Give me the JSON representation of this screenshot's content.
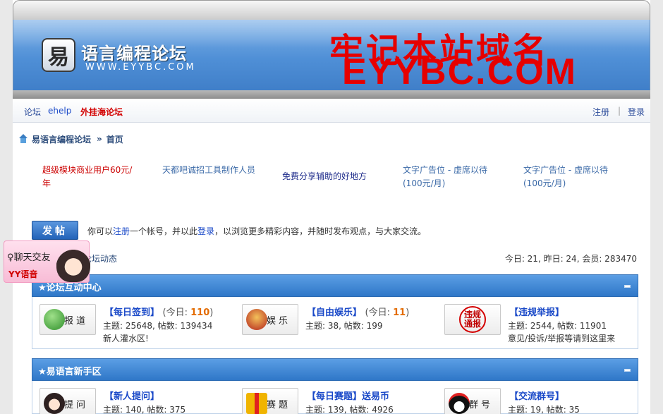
{
  "header": {
    "logo_char": "易",
    "logo_title": "语言编程论坛",
    "logo_url": "WWW.EYYBC.COM",
    "ad_cn": "牢记本站域名",
    "ad_en": "EYYBC.COM"
  },
  "nav": {
    "left": [
      "论坛",
      "ehelp",
      "外挂海论坛"
    ],
    "right": [
      "注册",
      "登录"
    ],
    "sep": "|"
  },
  "breadcrumb": {
    "site": "易语言编程论坛",
    "sep": "»",
    "current": "首页"
  },
  "text_ads": [
    "超级模块商业用户60元/年",
    "天都吧诚招工具制作人员",
    "免费分享辅助的好地方",
    "文字广告位 - 虚席以待(100元/月)",
    "文字广告位 - 虚席以待(100元/月)"
  ],
  "post": {
    "button": "发帖",
    "text_pre": "你可以",
    "register_link": "注册",
    "text_mid": "一个帐号，并以此",
    "login_link": "登录",
    "text_post": "，以浏览更多精彩内容，并随时发布观点，与大家交流。"
  },
  "dynamics_link": "论坛动态",
  "stats": "今日: 21, 昨日: 24, 会员: 283470",
  "categories": [
    {
      "title": "★论坛互动中心",
      "forums": [
        {
          "icon_label": "报道",
          "icon": "user-add-icon",
          "name": "【每日签到】",
          "today_label": "(今日: ",
          "today": "110",
          "today_end": ")",
          "stat": "主题: 25648, 帖数: 139434",
          "desc": "新人灌水区!"
        },
        {
          "icon_label": "娱乐",
          "icon": "game-icon",
          "name": "【自由娱乐】",
          "today_label": "(今日: ",
          "today": "11",
          "today_end": ")",
          "stat": "主题: 38, 帖数: 199",
          "desc": ""
        },
        {
          "icon_label": "违规通报",
          "icon": "report-stamp-icon",
          "name": "【违规举报】",
          "today_label": "",
          "today": "",
          "today_end": "",
          "stat": "主题: 2544, 帖数: 11901",
          "desc": "意见/投诉/举报等请到这里来"
        }
      ]
    },
    {
      "title": "★易语言新手区",
      "forums": [
        {
          "icon_label": "提问",
          "icon": "girl-avatar-icon",
          "name": "【新人提问】",
          "today_label": "",
          "today": "",
          "today_end": "",
          "stat": "主题: 140, 帖数: 375",
          "desc": ""
        },
        {
          "icon_label": "赛题",
          "icon": "gift-icon",
          "name": "【每日赛题】送易币",
          "today_label": "",
          "today": "",
          "today_end": "",
          "stat": "主题: 139, 帖数: 4926",
          "desc": ""
        },
        {
          "icon_label": "群号",
          "icon": "penguin-icon",
          "name": "【交流群号】",
          "today_label": "",
          "today": "",
          "today_end": "",
          "stat": "主题: 19, 帖数: 35",
          "desc": ""
        }
      ]
    }
  ],
  "chat_widget": {
    "line1": "♀聊天交友",
    "line2": "YY语音"
  },
  "colors": {
    "banner_blue": "#4f8fd6",
    "category_blue": "#2f77c8",
    "link_blue": "#1a49c8",
    "ad_red": "#e60000",
    "today_orange": "#e36b00"
  }
}
